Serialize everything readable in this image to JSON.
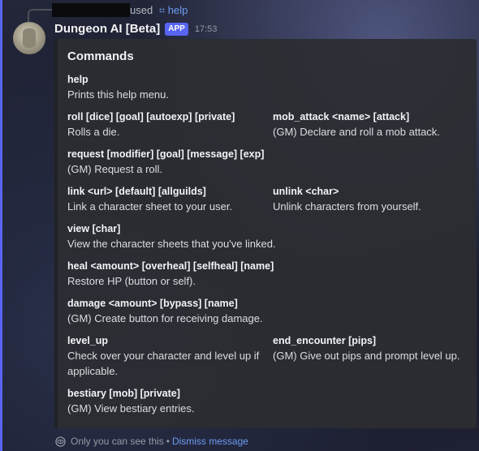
{
  "reply": {
    "used_text": "used",
    "command": "help",
    "command_icon": "slash-command-icon"
  },
  "message": {
    "username": "Dungeon AI [Beta]",
    "badge": "APP",
    "timestamp": "17:53"
  },
  "embed": {
    "title": "Commands",
    "fields": [
      {
        "name": "help",
        "value": "Prints this help menu."
      },
      {
        "name": "roll [dice] [goal] [autoexp] [private]",
        "value": "Rolls a die."
      },
      {
        "name": "mob_attack <name> [attack]",
        "value": "(GM) Declare and roll a mob attack."
      },
      {
        "name": "request [modifier] [goal] [message] [exp]",
        "value": "(GM) Request a roll."
      },
      {
        "name": "link <url> [default] [allguilds]",
        "value": "Link a character sheet to your user."
      },
      {
        "name": "unlink <char>",
        "value": "Unlink characters from yourself."
      },
      {
        "name": "view [char]",
        "value": "View the character sheets that you've linked."
      },
      {
        "name": "heal <amount> [overheal] [selfheal] [name]",
        "value": "Restore HP (button or self)."
      },
      {
        "name": "damage <amount> [bypass] [name]",
        "value": "(GM) Create button for receiving damage."
      },
      {
        "name": "level_up",
        "value": "Check over your character and level up if applicable."
      },
      {
        "name": "end_encounter [pips]",
        "value": "(GM) Give out pips and prompt level up."
      },
      {
        "name": "bestiary [mob] [private]",
        "value": "(GM) View bestiary entries."
      }
    ]
  },
  "footer": {
    "visibility_text": "Only you can see this",
    "separator": "•",
    "dismiss_label": "Dismiss message",
    "icon": "eye-icon"
  },
  "colors": {
    "accent": "#5865f2",
    "link": "#6e9bf2",
    "embed_bg": "#2b2d31"
  }
}
